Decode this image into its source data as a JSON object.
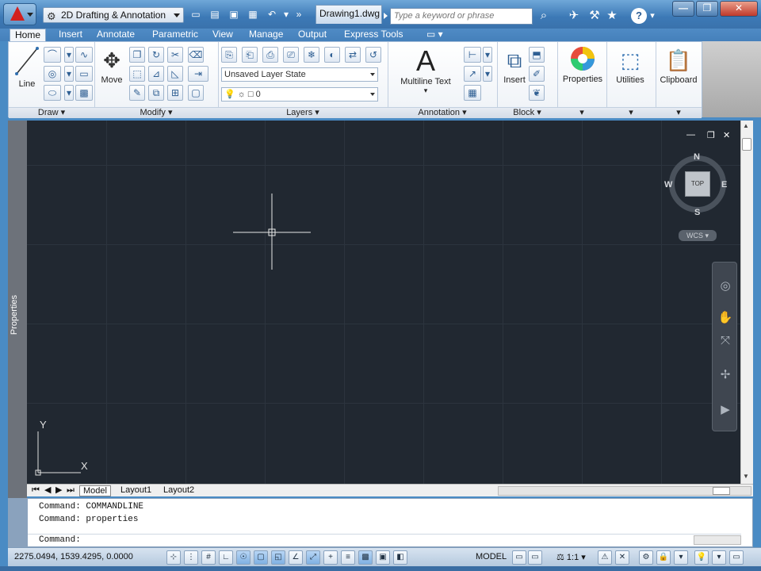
{
  "title_bar": {
    "workspace": "2D Drafting & Annotation",
    "document_tab": "Drawing1.dwg",
    "search_placeholder": "Type a keyword or phrase",
    "help": "?",
    "minimize": "—",
    "restore": "❐",
    "close": "✕"
  },
  "ribbon_tabs": [
    "Home",
    "Insert",
    "Annotate",
    "Parametric",
    "View",
    "Manage",
    "Output",
    "Express Tools"
  ],
  "panels": {
    "draw": {
      "title": "Draw",
      "line_label": "Line"
    },
    "modify": {
      "title": "Modify",
      "move_label": "Move"
    },
    "layers": {
      "title": "Layers",
      "layer_state": "Unsaved Layer State",
      "current_layer": "0"
    },
    "annotation": {
      "title": "Annotation",
      "multiline_label": "Multiline Text",
      "big_a": "A"
    },
    "block": {
      "title": "Block",
      "insert_label": "Insert"
    },
    "properties": {
      "label": "Properties"
    },
    "utilities": {
      "label": "Utilities"
    },
    "clipboard": {
      "label": "Clipboard"
    }
  },
  "viewcube": {
    "n": "N",
    "s": "S",
    "e": "E",
    "w": "W",
    "top": "TOP",
    "wcs": "WCS"
  },
  "side_palette": {
    "label": "Properties"
  },
  "ucs": {
    "x": "X",
    "y": "Y"
  },
  "layout_tabs": [
    "Model",
    "Layout1",
    "Layout2"
  ],
  "command": {
    "history": [
      "Command: COMMANDLINE",
      "Command: properties"
    ],
    "prompt": "Command:"
  },
  "status_bar": {
    "coordinates": "2275.0494, 1539.4295, 0.0000",
    "model": "MODEL",
    "scale": "1:1"
  },
  "colors": {
    "canvas": "#212831",
    "ribbon_bg": "#eef2f7",
    "title_bar": "#3c79b6"
  }
}
